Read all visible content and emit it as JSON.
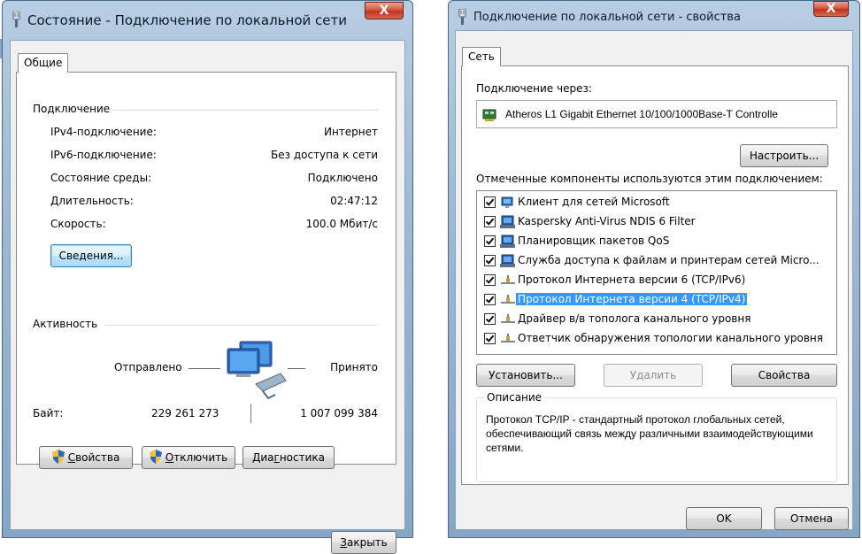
{
  "left_window": {
    "title": "Состояние - Подключение по локальной сети",
    "close_label": "X",
    "tab_label": "Общие",
    "connection": {
      "group_label": "Подключение",
      "rows": [
        {
          "label": "IPv4-подключение:",
          "value": "Интернет"
        },
        {
          "label": "IPv6-подключение:",
          "value": "Без доступа к сети"
        },
        {
          "label": "Состояние среды:",
          "value": "Подключено"
        },
        {
          "label": "Длительность:",
          "value": "02:47:12"
        },
        {
          "label": "Скорость:",
          "value": "100.0 Мбит/с"
        }
      ],
      "details_button": "Сведения..."
    },
    "activity": {
      "group_label": "Активность",
      "sent_label": "Отправлено",
      "received_label": "Принято",
      "bytes_label": "Байт:",
      "bytes_sent": "229 261 273",
      "bytes_received": "1 007 099 384"
    },
    "buttons": {
      "properties_pre": "",
      "properties_u": "С",
      "properties_post": "войства",
      "disconnect_u": "О",
      "disconnect_post": "тключить",
      "diag_pre": "Диа",
      "diag_u": "г",
      "diag_post": "ностика",
      "close_u": "З",
      "close_post": "акрыть"
    }
  },
  "right_window": {
    "title": "Подключение по локальной сети - свойства",
    "close_label": "X",
    "tab_label": "Сеть",
    "connect_using_label": "Подключение через:",
    "adapter_name": "Atheros L1 Gigabit Ethernet 10/100/1000Base-T Controlle",
    "configure_button": "Настроить...",
    "components_label": "Отмеченные компоненты используются этим подключением:",
    "components": [
      {
        "label": "Клиент для сетей Microsoft",
        "checked": true,
        "icon": "network-client-icon"
      },
      {
        "label": "Kaspersky Anti-Virus NDIS 6 Filter",
        "checked": true,
        "icon": "service-icon"
      },
      {
        "label": "Планировщик пакетов QoS",
        "checked": true,
        "icon": "service-icon"
      },
      {
        "label": "Служба доступа к файлам и принтерам сетей Micro...",
        "checked": true,
        "icon": "service-icon"
      },
      {
        "label": "Протокол Интернета версии 6 (TCP/IPv6)",
        "checked": true,
        "icon": "protocol-icon"
      },
      {
        "label": "Протокол Интернета версии 4 (TCP/IPv4)",
        "checked": true,
        "icon": "protocol-icon",
        "selected": true
      },
      {
        "label": "Драйвер в/в тополога канального уровня",
        "checked": true,
        "icon": "protocol-icon"
      },
      {
        "label": "Ответчик обнаружения топологии канального уровня",
        "checked": true,
        "icon": "protocol-icon"
      }
    ],
    "install_button": "Установить...",
    "remove_button": "Удалить",
    "properties_button": "Свойства",
    "description_label": "Описание",
    "description_text": "Протокол TCP/IP - стандартный протокол глобальных сетей, обеспечивающий связь между различными взаимодействующими сетями.",
    "ok_button": "OK",
    "cancel_button": "Отмена"
  },
  "colors": {
    "selection": "#3399ff",
    "close_button": "#c0331c",
    "frame": "#9db9d6"
  }
}
